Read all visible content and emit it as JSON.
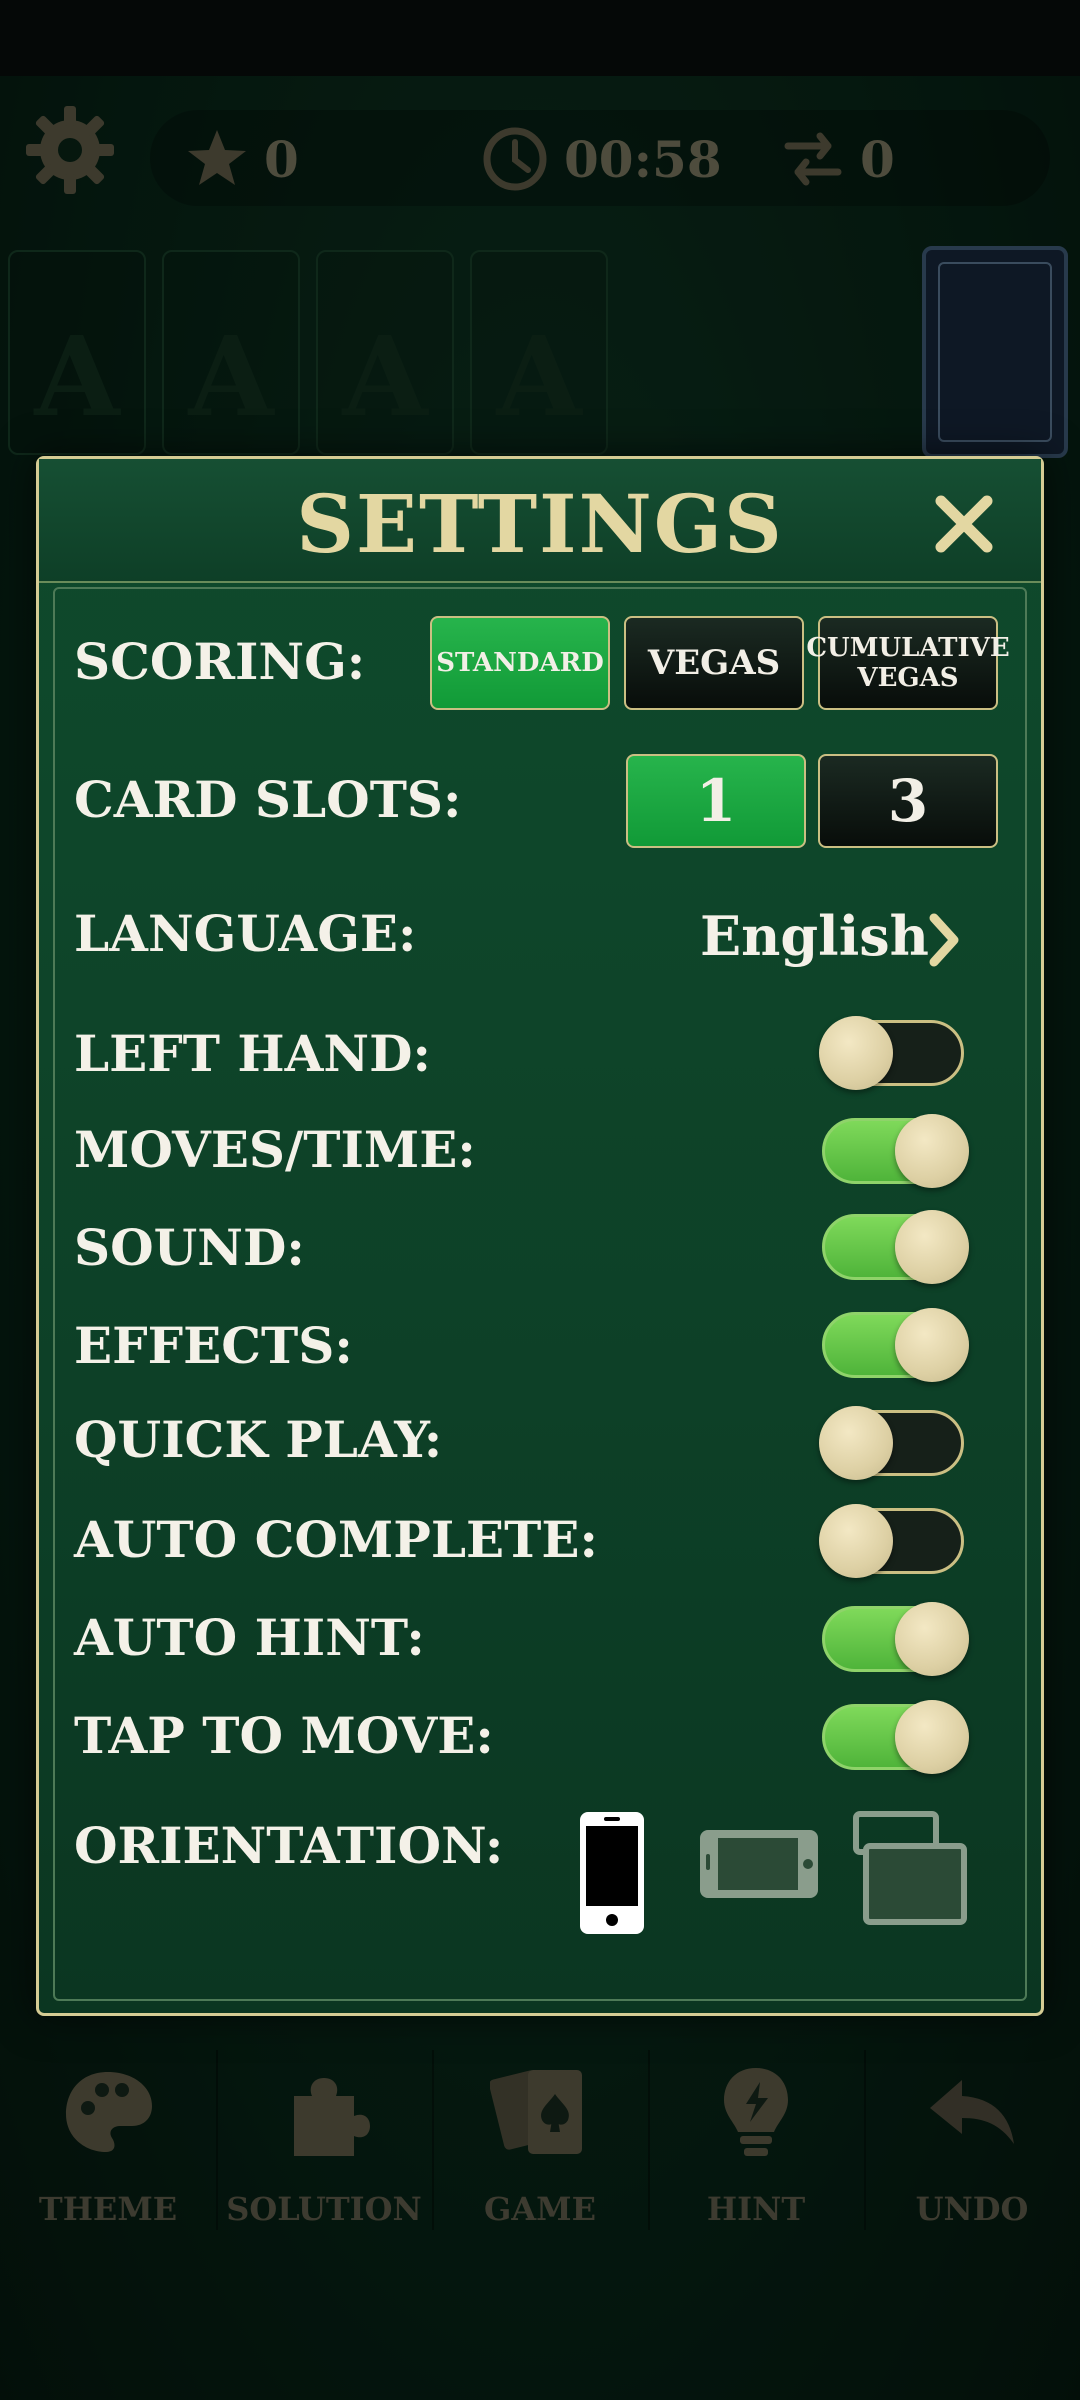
{
  "hud": {
    "stars": "0",
    "time": "00:58",
    "moves": "0"
  },
  "slots": {
    "letter": "A"
  },
  "dialog": {
    "title": "SETTINGS",
    "scoring": {
      "label": "SCORING:",
      "options": [
        "STANDARD",
        "VEGAS",
        "CUMULATIVE VEGAS"
      ],
      "selected": "STANDARD"
    },
    "card_slots": {
      "label": "CARD SLOTS:",
      "options": [
        "1",
        "3"
      ],
      "selected": "1"
    },
    "language": {
      "label": "LANGUAGE:",
      "value": "English"
    },
    "toggles": [
      {
        "label": "LEFT HAND:",
        "on": false
      },
      {
        "label": "MOVES/TIME:",
        "on": true
      },
      {
        "label": "SOUND:",
        "on": true
      },
      {
        "label": "EFFECTS:",
        "on": true
      },
      {
        "label": "QUICK PLAY:",
        "on": false
      },
      {
        "label": "AUTO COMPLETE:",
        "on": false
      },
      {
        "label": "AUTO HINT:",
        "on": true
      },
      {
        "label": "TAP TO MOVE:",
        "on": true
      }
    ],
    "orientation": {
      "label": "ORIENTATION:",
      "options": [
        "portrait-icon",
        "landscape-icon",
        "auto-rotate-icon"
      ],
      "selected": "portrait-icon"
    }
  },
  "toolbar": {
    "items": [
      "THEME",
      "SOLUTION",
      "GAME",
      "HINT",
      "UNDO"
    ]
  },
  "colors": {
    "accent_gold": "#d5cc94",
    "active_green": "#1ea83f",
    "toggle_on": "#66c64a",
    "panel_green": "#0f4a2c"
  }
}
